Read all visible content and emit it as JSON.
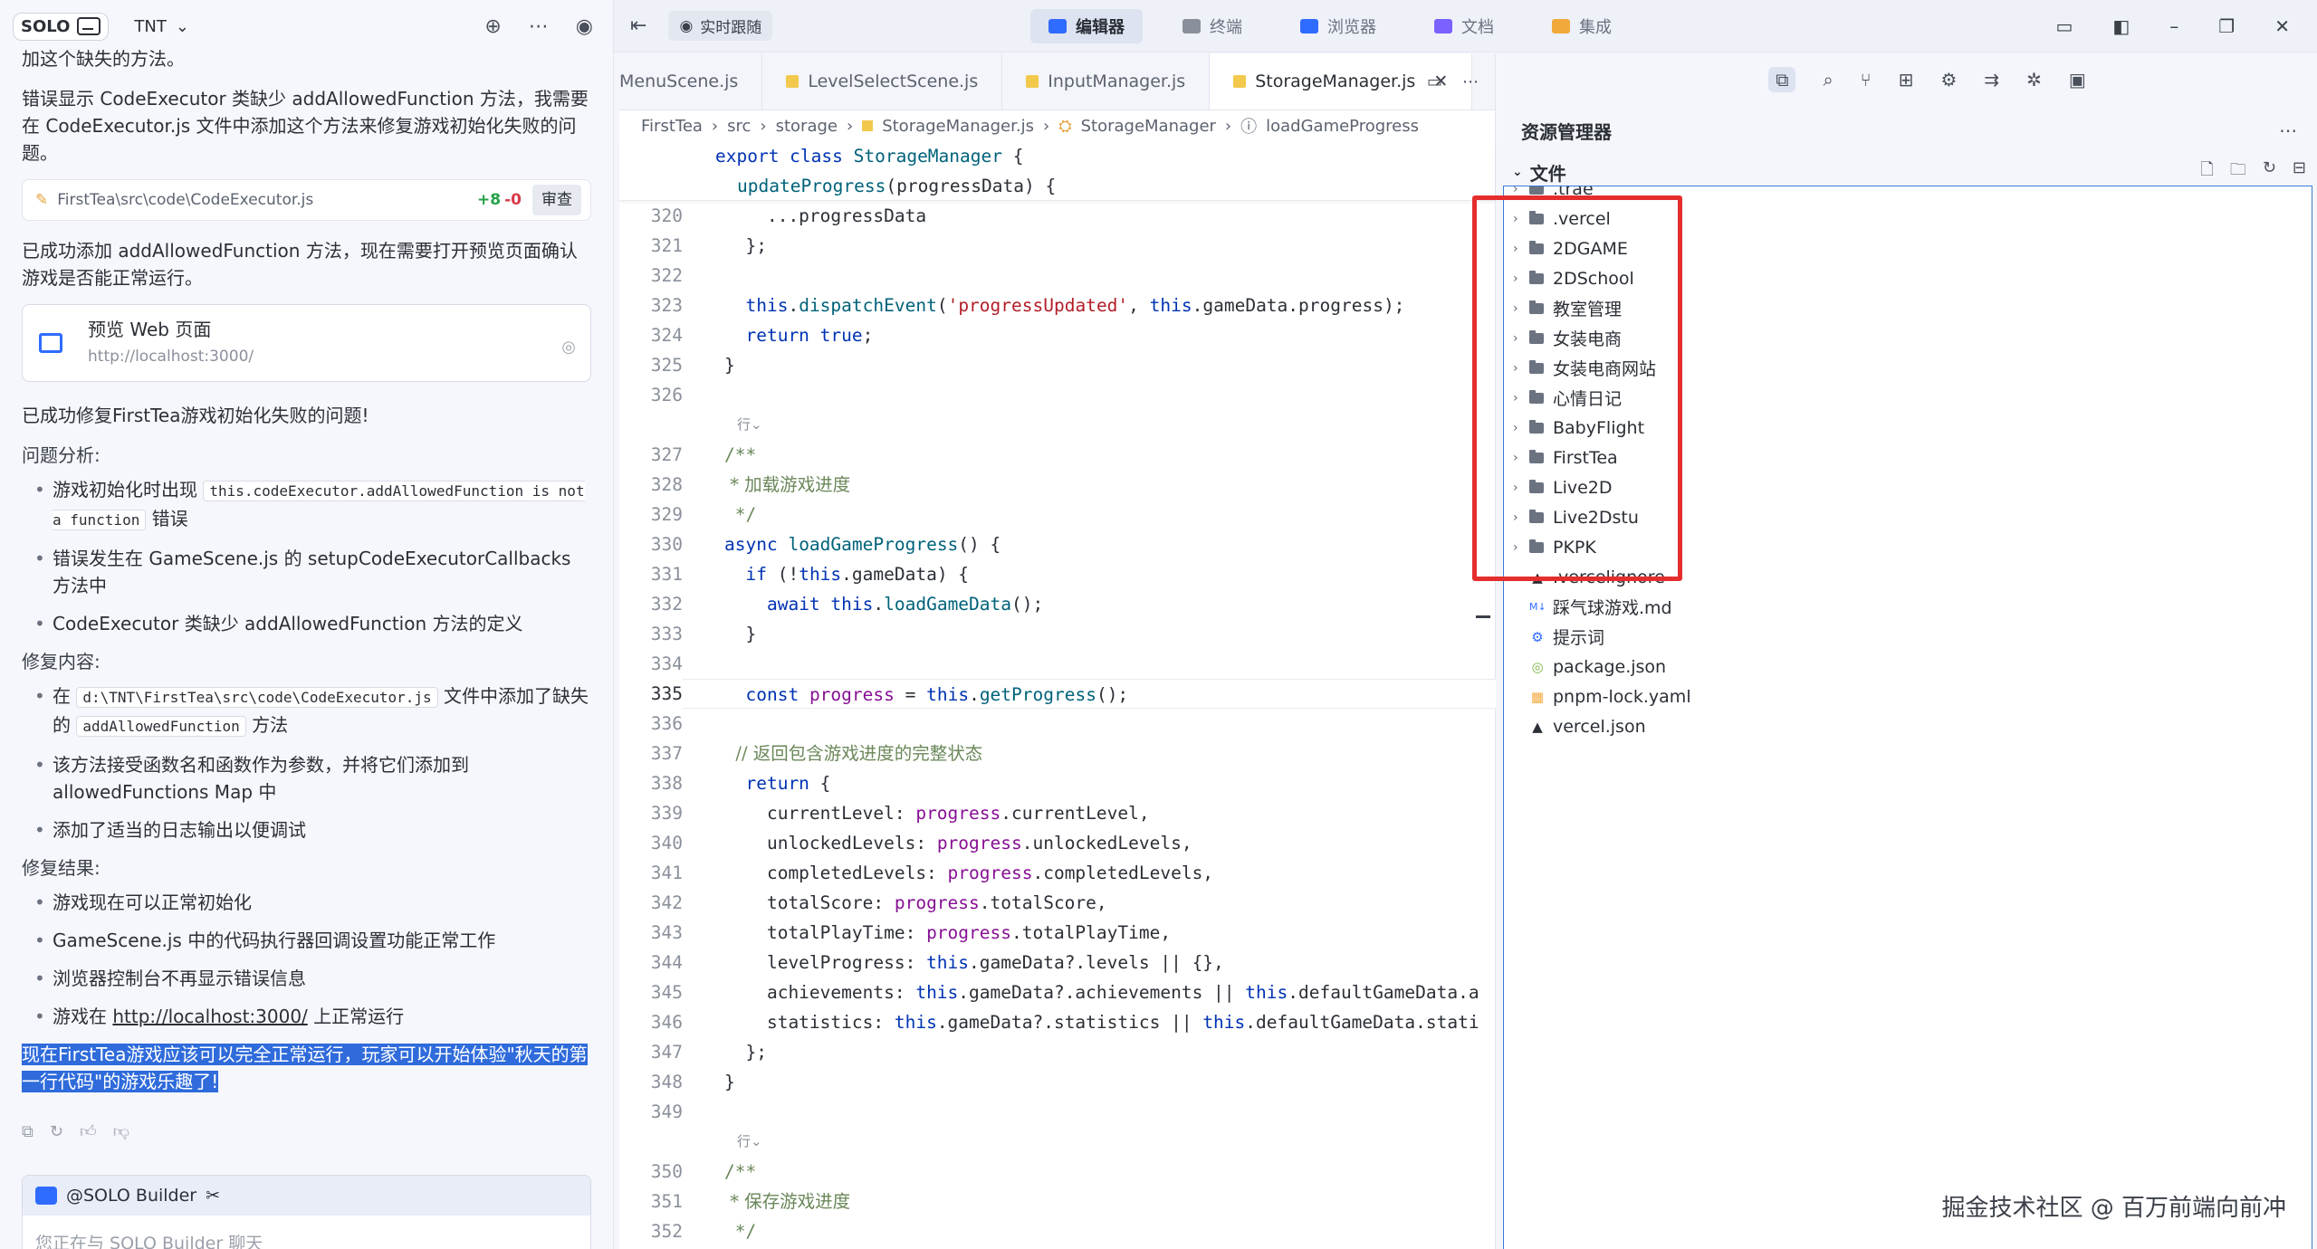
{
  "left": {
    "badge": "SOLO",
    "project": "TNT",
    "intro_tail": "加这个缺失的方法。",
    "msg1": "错误显示 CodeExecutor 类缺少 addAllowedFunction 方法，我需要在 CodeExecutor.js 文件中添加这个方法来修复游戏初始化失败的问题。",
    "file_card": {
      "path": "FirstTea\\src\\code\\CodeExecutor.js",
      "added": "+8",
      "removed": "-0",
      "review": "审查"
    },
    "msg2": "已成功添加 addAllowedFunction 方法，现在需要打开预览页面确认游戏是否能正常运行。",
    "preview": {
      "title": "预览 Web 页面",
      "url": "http://localhost:3000/"
    },
    "msg3": "已成功修复FirstTea游戏初始化失败的问题!",
    "analysis_title": "问题分析:",
    "analysis": [
      {
        "pre": "游戏初始化时出现 ",
        "code": "this.codeExecutor.addAllowedFunction is not a function",
        "post": " 错误"
      },
      {
        "pre": "错误发生在 GameScene.js 的 setupCodeExecutorCallbacks 方法中",
        "code": "",
        "post": ""
      },
      {
        "pre": "CodeExecutor 类缺少 addAllowedFunction 方法的定义",
        "code": "",
        "post": ""
      }
    ],
    "fix_title": "修复内容:",
    "fix": [
      {
        "pre": "在 ",
        "code": "d:\\TNT\\FirstTea\\src\\code\\CodeExecutor.js",
        "mid": " 文件中添加了缺失的 ",
        "code2": "addAllowedFunction",
        "post": " 方法"
      },
      {
        "pre": "该方法接受函数名和函数作为参数，并将它们添加到 allowedFunctions Map 中"
      },
      {
        "pre": "添加了适当的日志输出以便调试"
      }
    ],
    "result_title": "修复结果:",
    "results": [
      "游戏现在可以正常初始化",
      "GameScene.js 中的代码执行器回调设置功能正常工作",
      "浏览器控制台不再显示错误信息"
    ],
    "result_last_pre": "游戏在 ",
    "result_last_link": "http://localhost:3000/",
    "result_last_post": " 上正常运行",
    "highlight": "现在FirstTea游戏应该可以完全正常运行，玩家可以开始体验\"秋天的第一行代码\"的游戏乐趣了!",
    "builder_label": "@SOLO Builder",
    "builder_placeholder": "您正在与 SOLO Builder 聊天"
  },
  "topbar": {
    "follow": "实时跟随",
    "modes": [
      "编辑器",
      "终端",
      "浏览器",
      "文档",
      "集成"
    ],
    "active_mode": "编辑器"
  },
  "editor": {
    "tabs": [
      "MenuScene.js",
      "LevelSelectScene.js",
      "InputManager.js",
      "StorageManager.js"
    ],
    "active_tab": "StorageManager.js",
    "breadcrumb": [
      "FirstTea",
      "src",
      "storage",
      "StorageManager.js",
      "StorageManager",
      "loadGameProgress"
    ],
    "sticky1": "export class StorageManager {",
    "sticky2": "updateProgress(progressData) {",
    "hint": "行"
  },
  "explorer": {
    "title": "资源管理器",
    "files_label": "文件",
    "folders": [
      ".trae",
      ".vercel",
      "2DGAME",
      "2DSchool",
      "教室管理",
      "女装电商",
      "女装电商网站",
      "心情日记",
      "BabyFlight",
      "FirstTea",
      "Live2D",
      "Live2Dstu",
      "PKPK"
    ],
    "files": [
      ".vercelignore",
      "踩气球游戏.md",
      "提示词",
      "package.json",
      "pnpm-lock.yaml",
      "vercel.json"
    ]
  },
  "watermark": "掘金技术社区 @ 百万前端向前冲",
  "colors": {
    "accent": "#2f6bff",
    "highlight": "#e52d2d"
  }
}
